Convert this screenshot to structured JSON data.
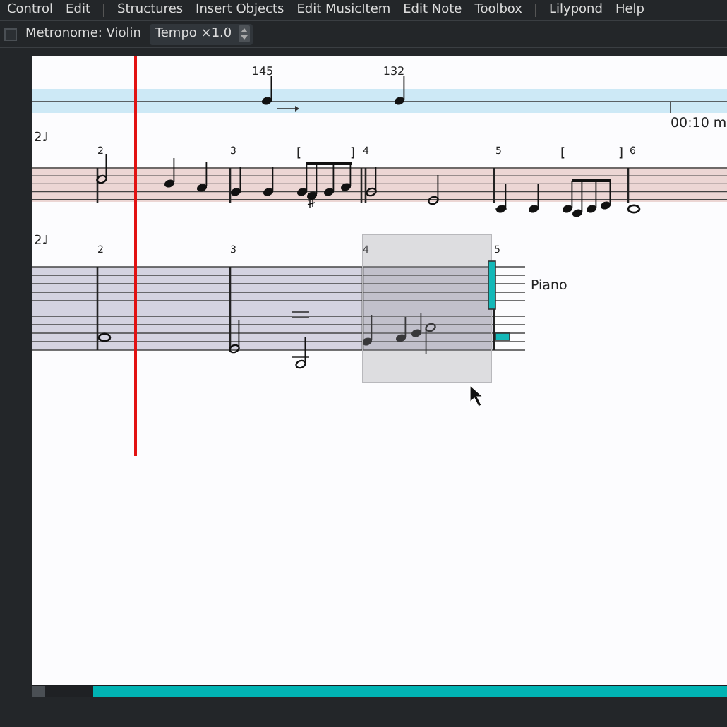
{
  "menu": [
    {
      "label": "Control"
    },
    {
      "label": "Edit"
    },
    {
      "kind": "separator"
    },
    {
      "label": "Structures"
    },
    {
      "label": "Insert Objects"
    },
    {
      "label": "Edit MusicItem"
    },
    {
      "label": "Edit Note"
    },
    {
      "label": "Toolbox"
    },
    {
      "kind": "separator"
    },
    {
      "label": "Lilypond"
    },
    {
      "label": "Help"
    }
  ],
  "toolbar": {
    "metronome": {
      "label": "Metronome: Violin",
      "checked": false
    },
    "tempo": {
      "value": "Tempo ×1.0"
    }
  },
  "score": {
    "tempo_marks": [
      "145",
      "132"
    ],
    "time_label": "00:10 m",
    "staves": [
      {
        "mark": "2♩",
        "measures": [
          "2",
          "3",
          "4",
          "5",
          "6"
        ],
        "brackets": [
          "[",
          "]",
          "[",
          "]"
        ]
      },
      {
        "mark": "2♩",
        "measures": [
          "2",
          "3",
          "4",
          "5"
        ],
        "name": "Piano"
      }
    ]
  }
}
